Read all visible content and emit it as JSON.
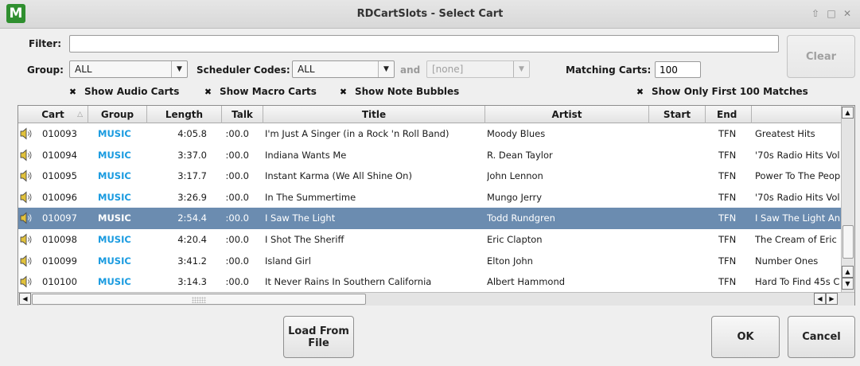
{
  "window": {
    "title": "RDCartSlots - Select Cart",
    "logo_glyph": "M"
  },
  "filter": {
    "label": "Filter:",
    "value": "",
    "clear_label": "Clear"
  },
  "group": {
    "label": "Group:",
    "value": "ALL"
  },
  "scheduler": {
    "label": "Scheduler Codes:",
    "value": "ALL",
    "and_label": "and",
    "second_value": "[none]"
  },
  "matching": {
    "label": "Matching Carts:",
    "value": "100"
  },
  "checkboxes": {
    "audio": "Show Audio Carts",
    "macro": "Show Macro Carts",
    "note": "Show Note Bubbles",
    "first": "Show Only First 100 Matches"
  },
  "columns": [
    "Cart",
    "Group",
    "Length",
    "Talk",
    "Title",
    "Artist",
    "Start",
    "End",
    ""
  ],
  "rows": [
    {
      "cart": "010093",
      "group": "MUSIC",
      "length": "4:05.8",
      "talk": ":00.0",
      "title": "I'm Just A Singer (in a Rock 'n Roll Band)",
      "artist": "Moody Blues",
      "start": "",
      "end": "TFN",
      "album": "Greatest Hits"
    },
    {
      "cart": "010094",
      "group": "MUSIC",
      "length": "3:37.0",
      "talk": ":00.0",
      "title": "Indiana Wants Me",
      "artist": "R. Dean Taylor",
      "start": "",
      "end": "TFN",
      "album": "'70s Radio Hits Vol"
    },
    {
      "cart": "010095",
      "group": "MUSIC",
      "length": "3:17.7",
      "talk": ":00.0",
      "title": "Instant Karma (We All Shine On)",
      "artist": "John Lennon",
      "start": "",
      "end": "TFN",
      "album": "Power To The Peop"
    },
    {
      "cart": "010096",
      "group": "MUSIC",
      "length": "3:26.9",
      "talk": ":00.0",
      "title": "In The Summertime",
      "artist": "Mungo Jerry",
      "start": "",
      "end": "TFN",
      "album": "'70s Radio Hits Vol"
    },
    {
      "cart": "010097",
      "group": "MUSIC",
      "length": "2:54.4",
      "talk": ":00.0",
      "title": "I Saw The Light",
      "artist": "Todd Rundgren",
      "start": "",
      "end": "TFN",
      "album": "I Saw The Light An",
      "selected": true
    },
    {
      "cart": "010098",
      "group": "MUSIC",
      "length": "4:20.4",
      "talk": ":00.0",
      "title": "I Shot The Sheriff",
      "artist": "Eric Clapton",
      "start": "",
      "end": "TFN",
      "album": "The Cream of Eric"
    },
    {
      "cart": "010099",
      "group": "MUSIC",
      "length": "3:41.2",
      "talk": ":00.0",
      "title": "Island Girl",
      "artist": "Elton John",
      "start": "",
      "end": "TFN",
      "album": "Number Ones"
    },
    {
      "cart": "010100",
      "group": "MUSIC",
      "length": "3:14.3",
      "talk": ":00.0",
      "title": "It Never Rains In Southern California",
      "artist": "Albert Hammond",
      "start": "",
      "end": "TFN",
      "album": "Hard To Find 45s C"
    }
  ],
  "buttons": {
    "load": "Load From\nFile",
    "ok": "OK",
    "cancel": "Cancel"
  },
  "colors": {
    "selection": "#6b8cb0",
    "group_text": "#1a9be0",
    "logo": "#2f8f2f"
  }
}
